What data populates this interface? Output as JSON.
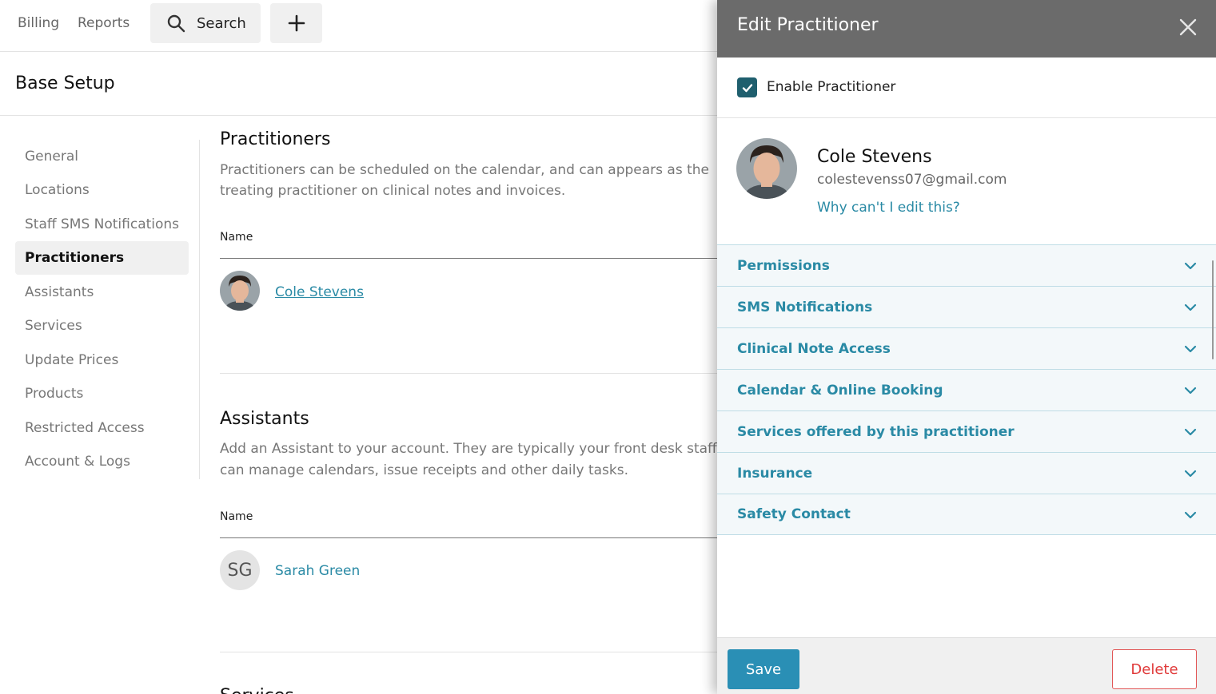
{
  "topbar": {
    "billing": "Billing",
    "reports": "Reports",
    "search_label": "Search",
    "search_icon": "search-icon",
    "add_icon": "plus-icon"
  },
  "page": {
    "title": "Base Setup"
  },
  "sidebar": {
    "items": [
      {
        "label": "General",
        "active": false
      },
      {
        "label": "Locations",
        "active": false
      },
      {
        "label": "Staff SMS Notifications",
        "active": false
      },
      {
        "label": "Practitioners",
        "active": true
      },
      {
        "label": "Assistants",
        "active": false
      },
      {
        "label": "Services",
        "active": false
      },
      {
        "label": "Update Prices",
        "active": false
      },
      {
        "label": "Products",
        "active": false
      },
      {
        "label": "Restricted Access",
        "active": false
      },
      {
        "label": "Account & Logs",
        "active": false
      }
    ]
  },
  "practitioners": {
    "title": "Practitioners",
    "desc_line1": "Practitioners can be scheduled on the calendar, and can appears as the",
    "desc_line2": "treating practitioner on clinical notes and invoices.",
    "column": "Name",
    "rows": [
      {
        "name": "Cole Stevens"
      }
    ]
  },
  "assistants": {
    "title": "Assistants",
    "desc_line1": "Add an Assistant to your account. They are typically your front desk staff w",
    "desc_line2": "can manage calendars, issue receipts and other daily tasks.",
    "column": "Name",
    "rows": [
      {
        "name": "Sarah Green",
        "initials": "SG"
      }
    ]
  },
  "next_section": {
    "title": "Services"
  },
  "drawer": {
    "title": "Edit Practitioner",
    "enable_label": "Enable Practitioner",
    "enabled": true,
    "name": "Cole Stevens",
    "email": "colestevenss07@gmail.com",
    "help_link": "Why can't I edit this?",
    "sections": [
      "Permissions",
      "SMS Notifications",
      "Clinical Note Access",
      "Calendar & Online Booking",
      "Services offered by this practitioner",
      "Insurance",
      "Safety Contact"
    ],
    "save_label": "Save",
    "delete_label": "Delete"
  },
  "colors": {
    "accent": "#2a8aa5",
    "save_button": "#2a8fb5",
    "delete": "#e03a3a",
    "drawer_header": "#6b6b6b",
    "checkbox": "#1f5f6e"
  }
}
